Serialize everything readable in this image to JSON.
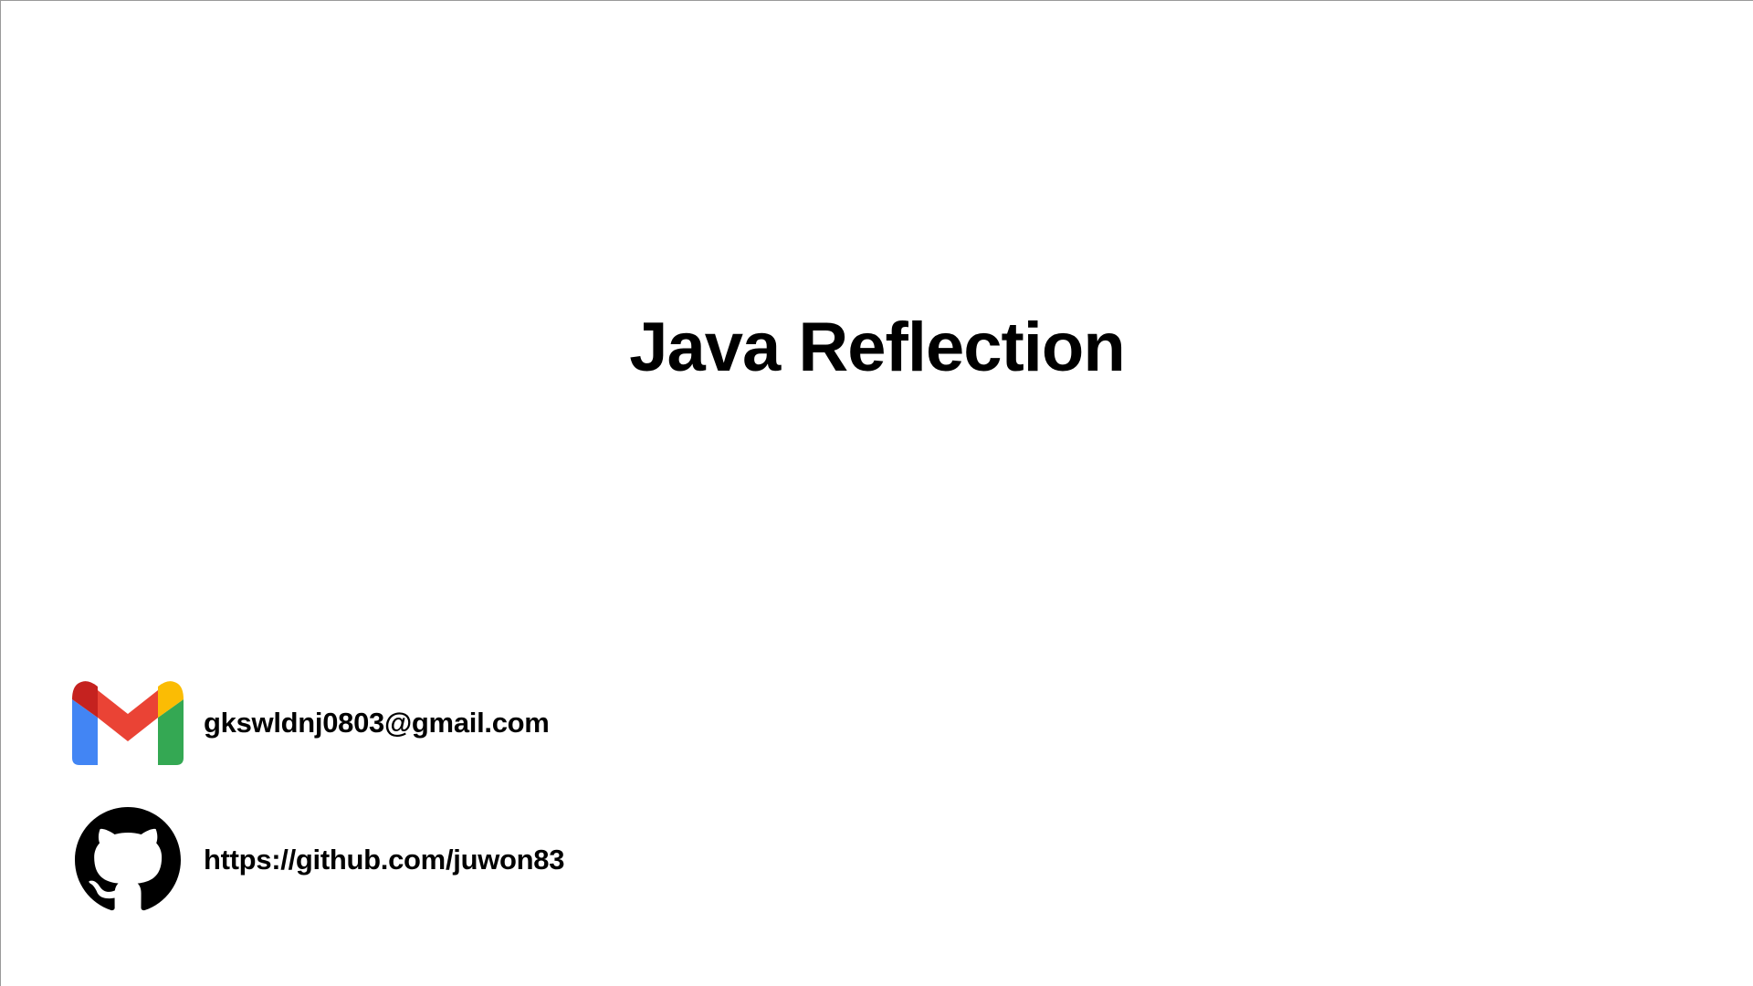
{
  "slide": {
    "title": "Java Reflection"
  },
  "contacts": {
    "email": {
      "icon": "gmail-icon",
      "text": "gkswldnj0803@gmail.com"
    },
    "github": {
      "icon": "github-icon",
      "text": "https://github.com/juwon83"
    }
  },
  "colors": {
    "gmail_blue": "#4285F4",
    "gmail_red": "#EA4335",
    "gmail_dark_red": "#C5221F",
    "gmail_yellow": "#FBBC04",
    "gmail_green": "#34A853",
    "text": "#000000",
    "background": "#FFFFFF"
  }
}
